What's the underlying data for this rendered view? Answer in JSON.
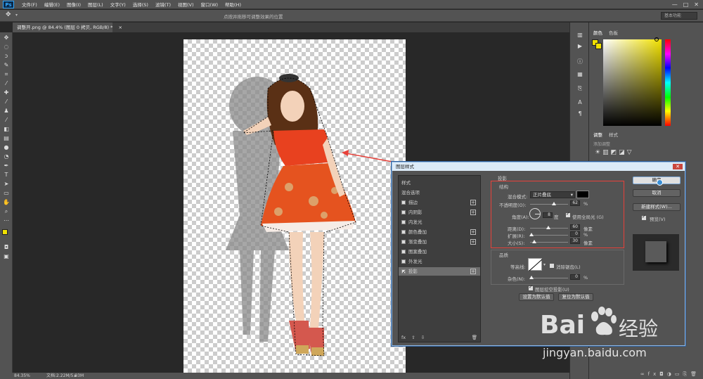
{
  "app": {
    "logo_text": "Ps"
  },
  "menubar": {
    "items": [
      "文件(F)",
      "编辑(E)",
      "图像(I)",
      "图层(L)",
      "文字(Y)",
      "选择(S)",
      "滤镜(T)",
      "视图(V)",
      "窗口(W)",
      "帮助(H)"
    ],
    "window_buttons": [
      "—",
      "□",
      "✕"
    ]
  },
  "options_bar": {
    "hint": "点按并拖移可调整效果的位置",
    "workspace": "基本功能"
  },
  "document": {
    "tab_title": "调整开.png @ 84.4% (图层 0 拷贝, RGB/8) *",
    "tab_close": "×"
  },
  "statusbar": {
    "zoom": "84.35%",
    "doc_info": "文档:2.22M/5.93M"
  },
  "panels": {
    "color_tabs": [
      "颜色",
      "色板"
    ],
    "adjust_tabs": [
      "调整",
      "样式"
    ],
    "adjust_hint": "添加调整"
  },
  "dialog": {
    "title": "图层样式",
    "close": "✕",
    "style_list_header": "样式",
    "blend_options": "混合选项",
    "styles": [
      {
        "label": "描边",
        "checked": false,
        "plus": true
      },
      {
        "label": "内阴影",
        "checked": false,
        "plus": true
      },
      {
        "label": "内发光",
        "checked": false,
        "plus": false
      },
      {
        "label": "颜色叠加",
        "checked": false,
        "plus": true
      },
      {
        "label": "渐变叠加",
        "checked": false,
        "plus": true
      },
      {
        "label": "图案叠加",
        "checked": false,
        "plus": false
      },
      {
        "label": "外发光",
        "checked": false,
        "plus": false
      },
      {
        "label": "投影",
        "checked": true,
        "plus": true,
        "selected": true
      }
    ],
    "list_footer": {
      "fx": "fx",
      "up": "⇧",
      "down": "⇩",
      "trash": "🗑"
    },
    "section": "投影",
    "structure": {
      "header": "结构",
      "blend_mode_label": "混合模式:",
      "blend_mode": "正片叠底",
      "opacity_label": "不透明度(O):",
      "opacity": "62",
      "angle_label": "角度(A):",
      "angle": "8",
      "degree": "度",
      "global_light": "使用全局光 (G)",
      "distance_label": "距离(D):",
      "distance": "60",
      "spread_label": "扩展(R):",
      "spread": "0",
      "size_label": "大小(S):",
      "size": "30",
      "unit_px": "像素",
      "unit_pct": "%"
    },
    "quality": {
      "header": "品质",
      "contour_label": "等高线:",
      "anti_alias": "消除锯齿(L)",
      "noise_label": "杂色(N):",
      "noise": "0"
    },
    "knockout": "图层挖空投影(U)",
    "make_default": "设置为默认值",
    "reset_default": "复位为默认值",
    "ok": "确定",
    "cancel": "取消",
    "new_style": "新建样式(W)...",
    "preview": "预览(V)"
  },
  "watermark": {
    "brand": "Bai",
    "brand_cn": "经验",
    "url": "jingyan.baidu.com"
  },
  "colors": {
    "accent_red": "#e8413a",
    "foreground": "#f1e100",
    "dialog_title": "#dcebf8"
  }
}
